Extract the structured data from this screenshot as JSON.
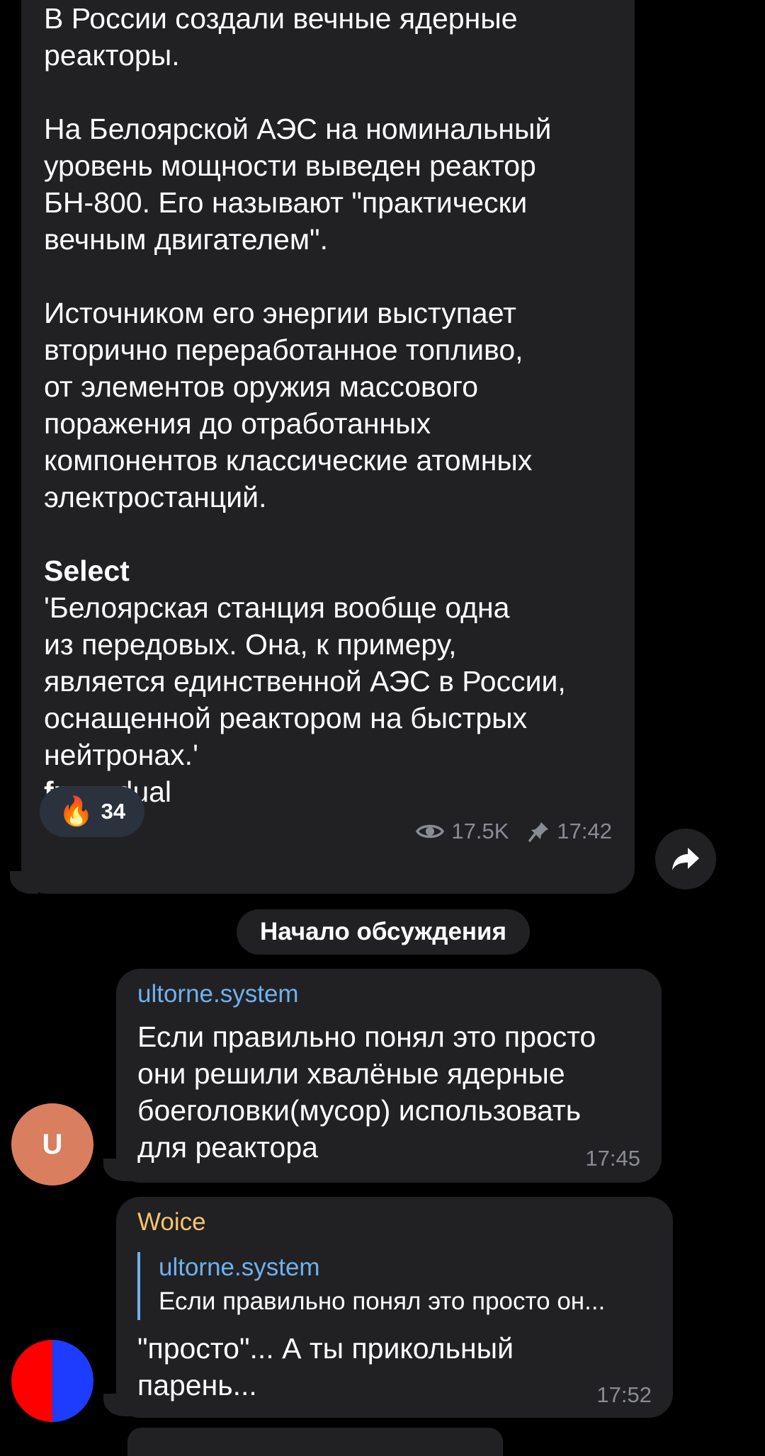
{
  "post": {
    "text_p1": "В России создали вечные ядерные\nреакторы.",
    "text_p2": "На Белоярской АЭС на номинальный\nуровень мощности выведен реактор\nБН-800. Его называют \"практически\nвечным двигателем\".",
    "text_p3": "Источником его энергии выступает\nвторично переработанное топливо,\nот элементов оружия массового\nпоражения до отработанных\nкомпонентов классические атомных\nэлектростанций.",
    "select_label": "Select",
    "quote_text": "'Белоярская станция вообще одна\nиз передовых. Она, к примеру,\nявляется единственной АЭС в России,\nоснащенной реактором на быстрых\nнейтронах.'",
    "from_label": "from",
    "from_name": "dual",
    "reaction_emoji": "🔥",
    "reaction_count": "34",
    "views": "17.5K",
    "time": "17:42",
    "icons": [
      "eye-icon",
      "pin-icon",
      "share-arrow-icon",
      "fire-emoji"
    ]
  },
  "discussion_label": "Начало обсуждения",
  "comments": [
    {
      "author": "ultorne.system",
      "author_color": "#6fb1ed",
      "avatar_letter": "U",
      "avatar_color": "#d97e5f",
      "text": "Если правильно понял это просто\nони решили хвалёные ядерные\nбоеголовки(мусор) использовать\nдля реактора",
      "time": "17:45"
    },
    {
      "author": "Woice",
      "author_color": "#f7c46c",
      "avatar_colors": [
        "#ff0000",
        "#1e3cff"
      ],
      "reply_author": "ultorne.system",
      "reply_text": "Если правильно понял это просто он...",
      "text": "\"просто\"... А ты прикольный\nпарень...",
      "time": "17:52"
    }
  ]
}
